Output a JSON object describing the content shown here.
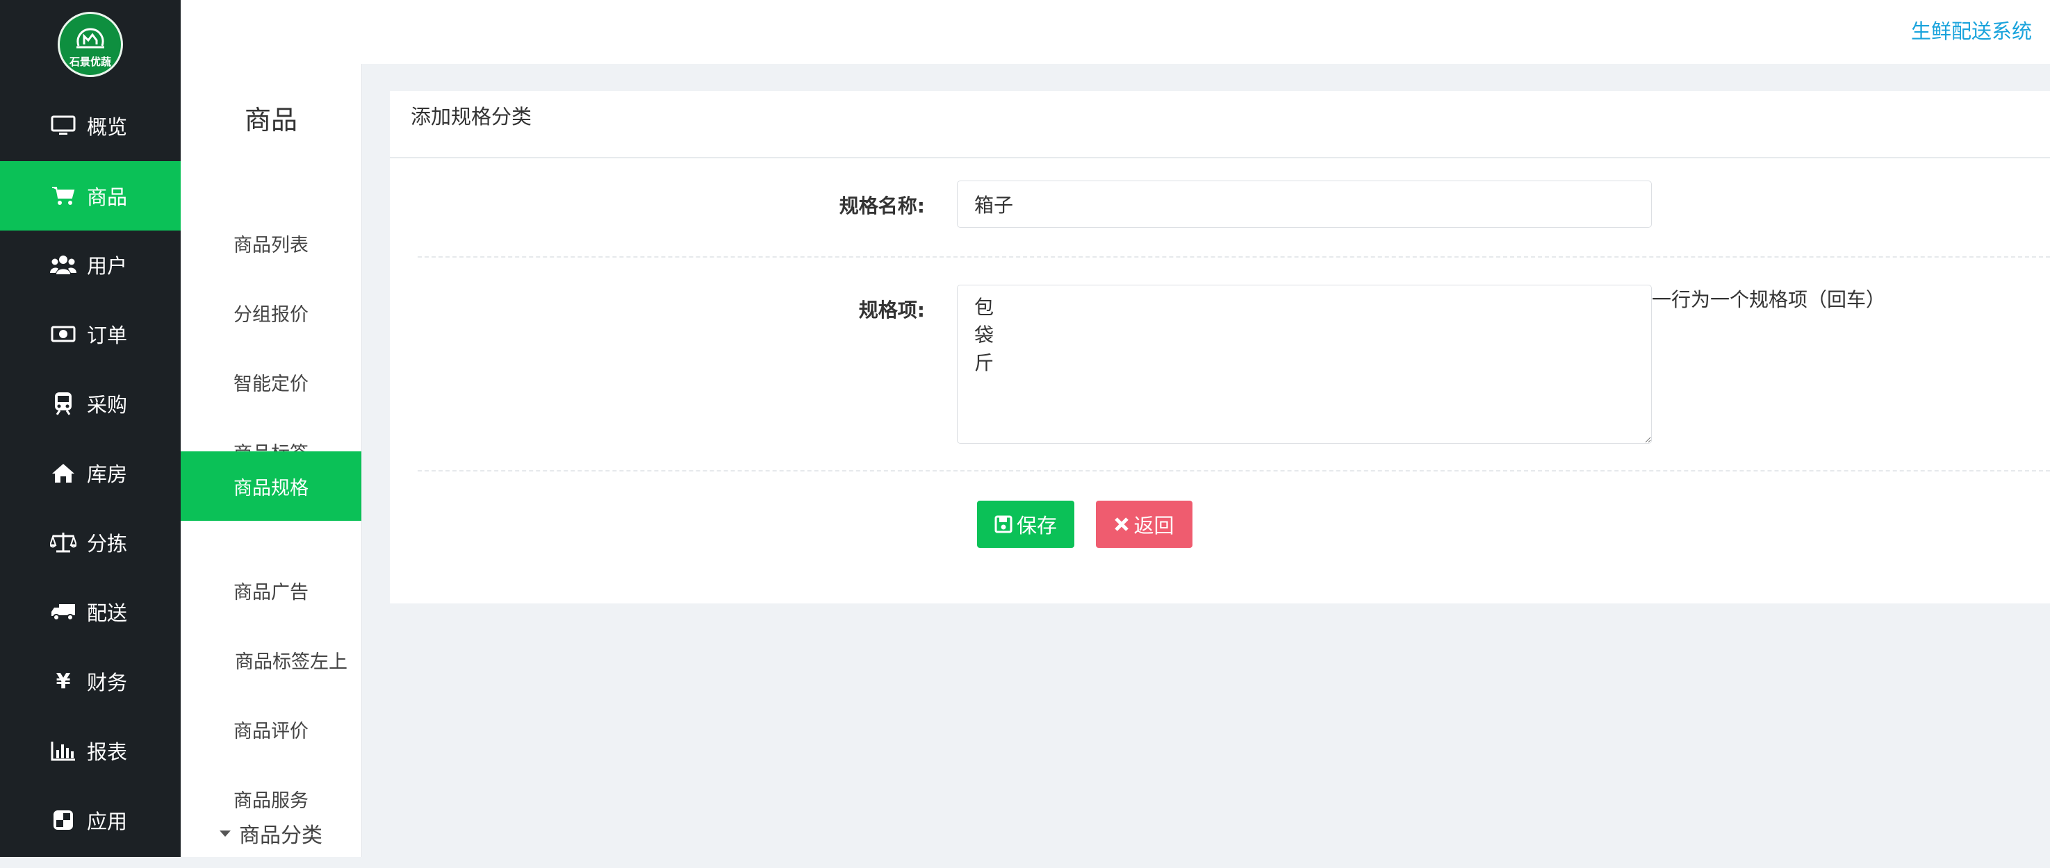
{
  "app": {
    "logo_text": "石景优蔬",
    "brand": "生鲜配送系统"
  },
  "colors": {
    "accent_green": "#0bc157",
    "danger_red": "#ef5c6f",
    "brand_blue": "#19a3dc",
    "sidebar_dark": "#1c2125"
  },
  "leftnav": {
    "items": [
      {
        "label": "概览",
        "icon": "monitor-icon"
      },
      {
        "label": "商品",
        "icon": "cart-icon",
        "active": true
      },
      {
        "label": "用户",
        "icon": "users-icon"
      },
      {
        "label": "订单",
        "icon": "money-icon"
      },
      {
        "label": "采购",
        "icon": "train-icon"
      },
      {
        "label": "库房",
        "icon": "home-icon"
      },
      {
        "label": "分拣",
        "icon": "balance-scale-icon"
      },
      {
        "label": "配送",
        "icon": "truck-icon"
      },
      {
        "label": "财务",
        "icon": "yen-icon"
      },
      {
        "label": "报表",
        "icon": "bar-chart-icon"
      },
      {
        "label": "应用",
        "icon": "apps-icon"
      }
    ]
  },
  "subnav": {
    "title": "商品",
    "items": [
      {
        "label": "商品列表"
      },
      {
        "label": "分组报价"
      },
      {
        "label": "智能定价"
      },
      {
        "label": "商品标签"
      },
      {
        "label": "商品规格",
        "active": true
      },
      {
        "label": "商品广告"
      },
      {
        "label": "商品标签左上"
      },
      {
        "label": "商品评价"
      },
      {
        "label": "商品服务"
      }
    ],
    "group": {
      "label": "商品分类",
      "icon": "caret-down-icon"
    }
  },
  "form": {
    "title": "添加规格分类",
    "name_label": "规格名称:",
    "name_value": "箱子",
    "items_label": "规格项:",
    "items_value": "包\n袋\n斤",
    "items_hint": "一行为一个规格项（回车）",
    "save_label": "保存",
    "save_icon": "save-icon",
    "back_label": "返回",
    "back_icon": "close-icon"
  }
}
